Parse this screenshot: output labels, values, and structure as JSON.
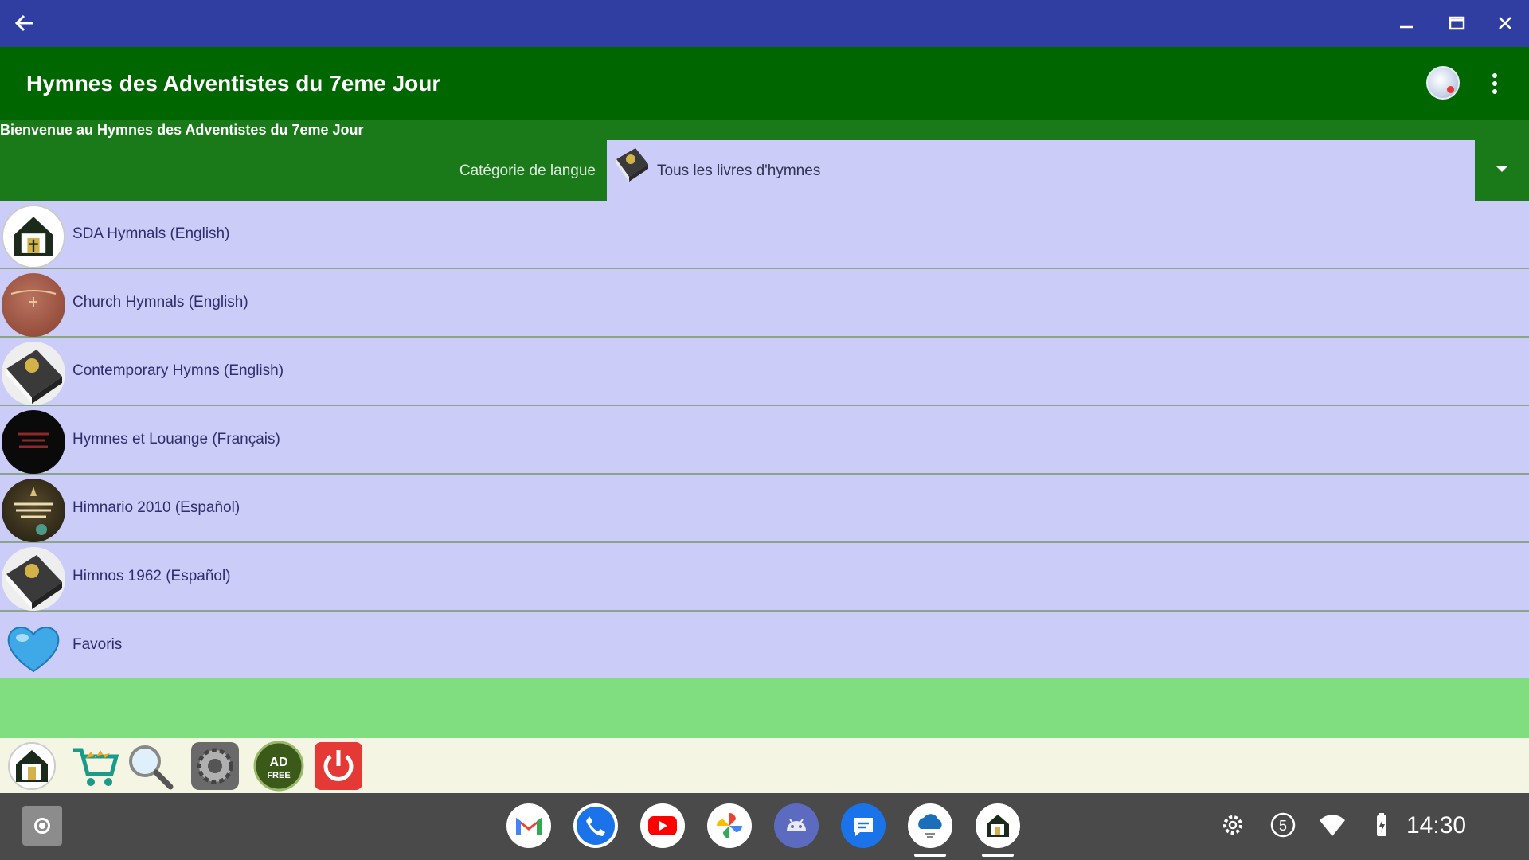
{
  "window": {
    "back_icon": "arrow-left-icon",
    "minimize_icon": "minimize-icon",
    "maximize_icon": "maximize-icon",
    "close_icon": "close-icon"
  },
  "appbar": {
    "title": "Hymnes des Adventistes du 7eme Jour",
    "avatar_icon": "account-avatar-icon",
    "menu_icon": "more-vert-icon"
  },
  "welcome": "Bienvenue au Hymnes des Adventistes du 7eme Jour",
  "category": {
    "label": "Catégorie de langue",
    "selected": "Tous les livres d'hymnes",
    "icon": "hymn-book-icon",
    "dropdown_icon": "arrow-drop-down-icon"
  },
  "hymnals": [
    {
      "label": "SDA Hymnals (English)",
      "icon": "church-logo-icon"
    },
    {
      "label": "Church Hymnals (English)",
      "icon": "church-hymnal-cover-icon"
    },
    {
      "label": "Contemporary Hymns (English)",
      "icon": "hymn-book-icon"
    },
    {
      "label": "Hymnes et Louange (Français)",
      "icon": "hymnes-louange-cover-icon"
    },
    {
      "label": "Himnario 2010 (Español)",
      "icon": "himnario-cover-icon"
    },
    {
      "label": "Himnos 1962 (Español)",
      "icon": "hymn-book-icon"
    },
    {
      "label": "Favoris",
      "icon": "heart-icon"
    }
  ],
  "toolbar": {
    "items": [
      "home-icon",
      "cart-icon",
      "search-icon",
      "settings-gear-icon",
      "ad-free-icon",
      "power-icon"
    ],
    "ad_free_text": [
      "AD",
      "FREE"
    ]
  },
  "taskbar": {
    "apps": [
      "gmail-icon",
      "phone-icon",
      "youtube-icon",
      "photos-icon",
      "android-icon",
      "messages-icon",
      "cloud-app-icon",
      "hymnal-app-icon"
    ],
    "tray": [
      "settings-icon",
      "notification-count-icon",
      "wifi-icon",
      "battery-icon"
    ],
    "notification_count": "5",
    "time": "14:30"
  }
}
